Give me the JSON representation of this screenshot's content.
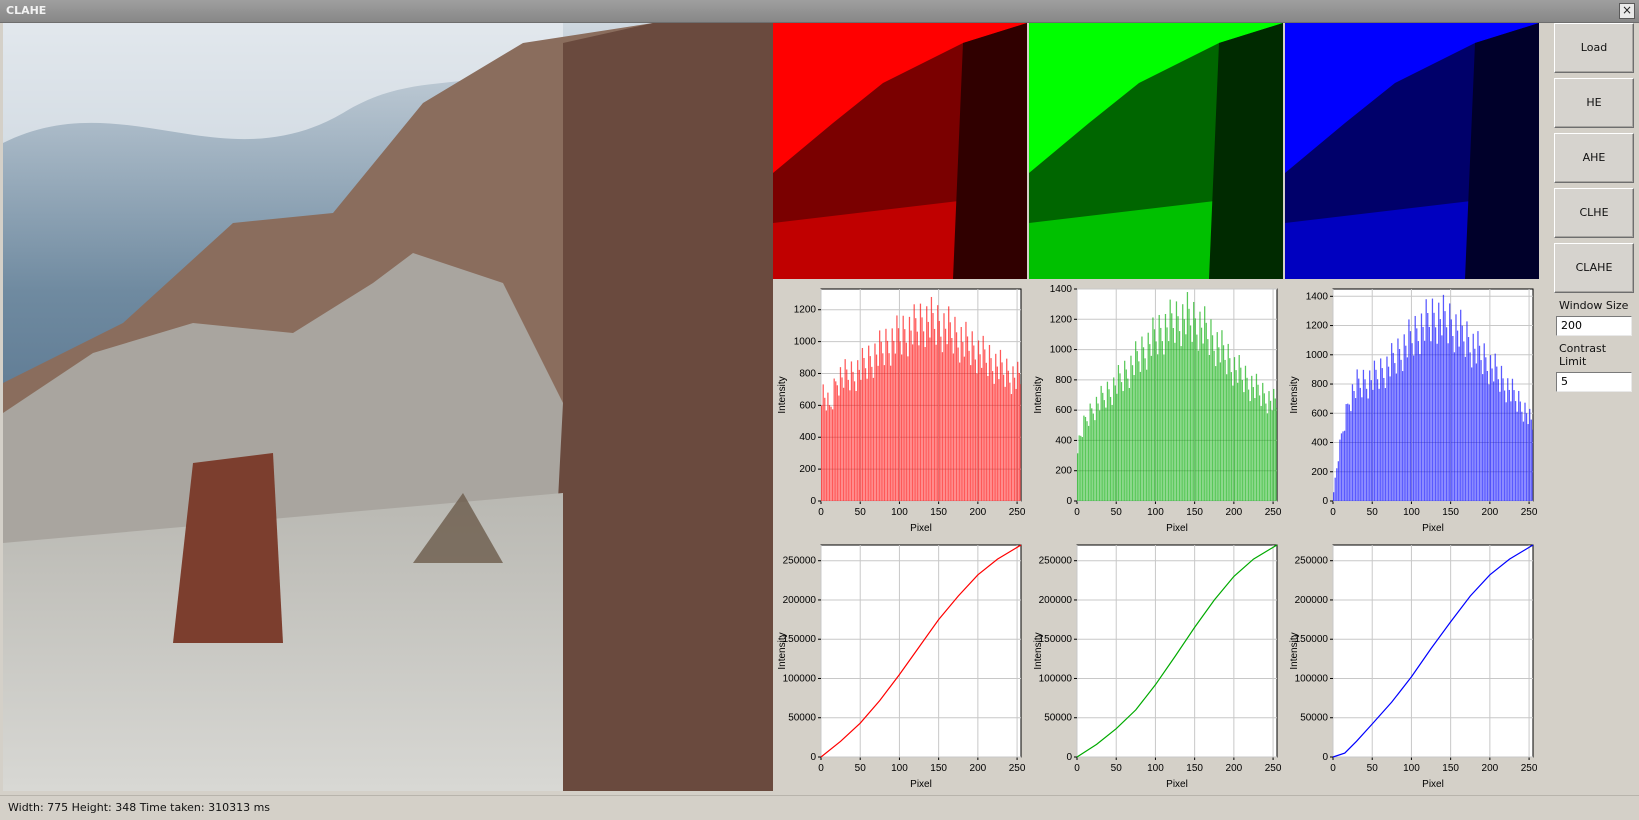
{
  "window": {
    "title": "CLAHE",
    "close_glyph": "×"
  },
  "buttons": [
    "Load",
    "HE",
    "AHE",
    "CLHE",
    "CLAHE"
  ],
  "fields": {
    "window_size_label": "Window Size",
    "window_size_value": "200",
    "contrast_limit_label": "Contrast Limit",
    "contrast_limit_value": "5"
  },
  "status": {
    "text": "Width: 775 Height: 348 Time taken: 310313 ms"
  },
  "colors": {
    "red": "#ff0000",
    "green": "#00aa00",
    "blue": "#0000ff"
  },
  "chart_data": [
    {
      "type": "bar",
      "channel": "red",
      "xlabel": "Pixel",
      "ylabel": "Intensity",
      "xlim": [
        0,
        255
      ],
      "ylim": [
        0,
        1330
      ],
      "xticks": [
        0,
        50,
        100,
        150,
        200,
        250
      ],
      "yticks": [
        0,
        200,
        400,
        600,
        800,
        1000,
        1200
      ],
      "profile": [
        [
          0,
          800
        ],
        [
          10,
          650
        ],
        [
          20,
          880
        ],
        [
          40,
          900
        ],
        [
          60,
          1000
        ],
        [
          80,
          1100
        ],
        [
          100,
          1180
        ],
        [
          120,
          1240
        ],
        [
          130,
          1290
        ],
        [
          140,
          1280
        ],
        [
          160,
          1230
        ],
        [
          180,
          1140
        ],
        [
          200,
          1060
        ],
        [
          220,
          980
        ],
        [
          240,
          900
        ],
        [
          255,
          860
        ]
      ]
    },
    {
      "type": "bar",
      "channel": "green",
      "xlabel": "Pixel",
      "ylabel": "Intensity",
      "xlim": [
        0,
        255
      ],
      "ylim": [
        0,
        1400
      ],
      "xticks": [
        0,
        50,
        100,
        150,
        200,
        250
      ],
      "yticks": [
        0,
        200,
        400,
        600,
        800,
        1000,
        1200,
        1400
      ],
      "profile": [
        [
          0,
          420
        ],
        [
          10,
          600
        ],
        [
          20,
          700
        ],
        [
          40,
          820
        ],
        [
          60,
          950
        ],
        [
          80,
          1100
        ],
        [
          100,
          1240
        ],
        [
          120,
          1340
        ],
        [
          140,
          1380
        ],
        [
          160,
          1300
        ],
        [
          180,
          1160
        ],
        [
          200,
          1000
        ],
        [
          220,
          880
        ],
        [
          240,
          780
        ],
        [
          255,
          720
        ]
      ]
    },
    {
      "type": "bar",
      "channel": "blue",
      "xlabel": "Pixel",
      "ylabel": "Intensity",
      "xlim": [
        0,
        255
      ],
      "ylim": [
        0,
        1450
      ],
      "xticks": [
        0,
        50,
        100,
        150,
        200,
        250
      ],
      "yticks": [
        0,
        200,
        400,
        600,
        800,
        1000,
        1200,
        1400
      ],
      "profile": [
        [
          0,
          80
        ],
        [
          5,
          300
        ],
        [
          10,
          500
        ],
        [
          20,
          800
        ],
        [
          30,
          900
        ],
        [
          50,
          950
        ],
        [
          70,
          1050
        ],
        [
          90,
          1200
        ],
        [
          110,
          1340
        ],
        [
          130,
          1440
        ],
        [
          150,
          1380
        ],
        [
          170,
          1260
        ],
        [
          190,
          1120
        ],
        [
          210,
          980
        ],
        [
          230,
          820
        ],
        [
          245,
          700
        ],
        [
          255,
          560
        ]
      ]
    },
    {
      "type": "line",
      "channel": "red",
      "xlabel": "Pixel",
      "ylabel": "Intensity",
      "xlim": [
        0,
        255
      ],
      "ylim": [
        0,
        270000
      ],
      "xticks": [
        0,
        50,
        100,
        150,
        200,
        250
      ],
      "yticks": [
        0,
        50000,
        100000,
        150000,
        200000,
        250000
      ],
      "points": [
        [
          0,
          0
        ],
        [
          25,
          20000
        ],
        [
          50,
          43000
        ],
        [
          75,
          72000
        ],
        [
          100,
          105000
        ],
        [
          125,
          140000
        ],
        [
          150,
          175000
        ],
        [
          175,
          205000
        ],
        [
          200,
          232000
        ],
        [
          225,
          252000
        ],
        [
          255,
          270000
        ]
      ]
    },
    {
      "type": "line",
      "channel": "green",
      "xlabel": "Pixel",
      "ylabel": "Intensity",
      "xlim": [
        0,
        255
      ],
      "ylim": [
        0,
        270000
      ],
      "xticks": [
        0,
        50,
        100,
        150,
        200,
        250
      ],
      "yticks": [
        0,
        50000,
        100000,
        150000,
        200000,
        250000
      ],
      "points": [
        [
          0,
          0
        ],
        [
          25,
          16000
        ],
        [
          50,
          36000
        ],
        [
          75,
          60000
        ],
        [
          100,
          92000
        ],
        [
          125,
          128000
        ],
        [
          150,
          165000
        ],
        [
          175,
          200000
        ],
        [
          200,
          230000
        ],
        [
          225,
          252000
        ],
        [
          255,
          270000
        ]
      ]
    },
    {
      "type": "line",
      "channel": "blue",
      "xlabel": "Pixel",
      "ylabel": "Intensity",
      "xlim": [
        0,
        255
      ],
      "ylim": [
        0,
        270000
      ],
      "xticks": [
        0,
        50,
        100,
        150,
        200,
        250
      ],
      "yticks": [
        0,
        50000,
        100000,
        150000,
        200000,
        250000
      ],
      "points": [
        [
          0,
          0
        ],
        [
          15,
          5000
        ],
        [
          30,
          20000
        ],
        [
          50,
          42000
        ],
        [
          75,
          70000
        ],
        [
          100,
          102000
        ],
        [
          125,
          138000
        ],
        [
          150,
          172000
        ],
        [
          175,
          205000
        ],
        [
          200,
          232000
        ],
        [
          225,
          252000
        ],
        [
          255,
          270000
        ]
      ]
    }
  ]
}
